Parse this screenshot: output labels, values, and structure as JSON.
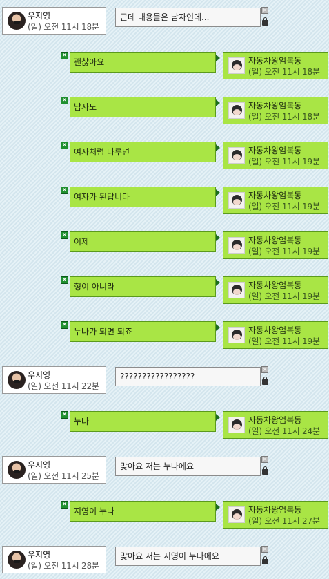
{
  "names": {
    "user": "우지영",
    "other": "자동차왕엄복동"
  },
  "icons": {
    "user_avatar": "profile-avatar",
    "other_avatar": "profile-avatar",
    "close": "close-x",
    "lock": "lock"
  },
  "colors": {
    "received_bubble": "#a9e545",
    "sent_bubble": "#f7f7f7",
    "close_green": "#1f8f2f"
  },
  "messages": [
    {
      "side": "left",
      "text": "근데 내용물은 남자인데...",
      "time": "(일) 오전 11시 18분"
    },
    {
      "side": "right",
      "text": "괜찮아요",
      "time": "(일) 오전 11시 18분"
    },
    {
      "side": "right",
      "text": "남자도",
      "time": "(일) 오전 11시 18분"
    },
    {
      "side": "right",
      "text": "여자처럼 다루면",
      "time": "(일) 오전 11시 19분"
    },
    {
      "side": "right",
      "text": "여자가 된답니다",
      "time": "(일) 오전 11시 19분"
    },
    {
      "side": "right",
      "text": "이제",
      "time": "(일) 오전 11시 19분"
    },
    {
      "side": "right",
      "text": "형이 아니라",
      "time": "(일) 오전 11시 19분"
    },
    {
      "side": "right",
      "text": "누나가 되면 되죠",
      "time": "(일) 오전 11시 19분"
    },
    {
      "side": "left",
      "text": "?????????????????",
      "time": "(일) 오전 11시 22분"
    },
    {
      "side": "right",
      "text": "누나",
      "time": "(일) 오전 11시 24분"
    },
    {
      "side": "left",
      "text": "맞아요 저는 누나에요",
      "time": "(일) 오전 11시 25분"
    },
    {
      "side": "right",
      "text": "지영이 누나",
      "time": "(일) 오전 11시 27분"
    },
    {
      "side": "left",
      "text": "맞아요 저는 지영이 누나에요",
      "time": "(일) 오전 11시 28분"
    }
  ]
}
